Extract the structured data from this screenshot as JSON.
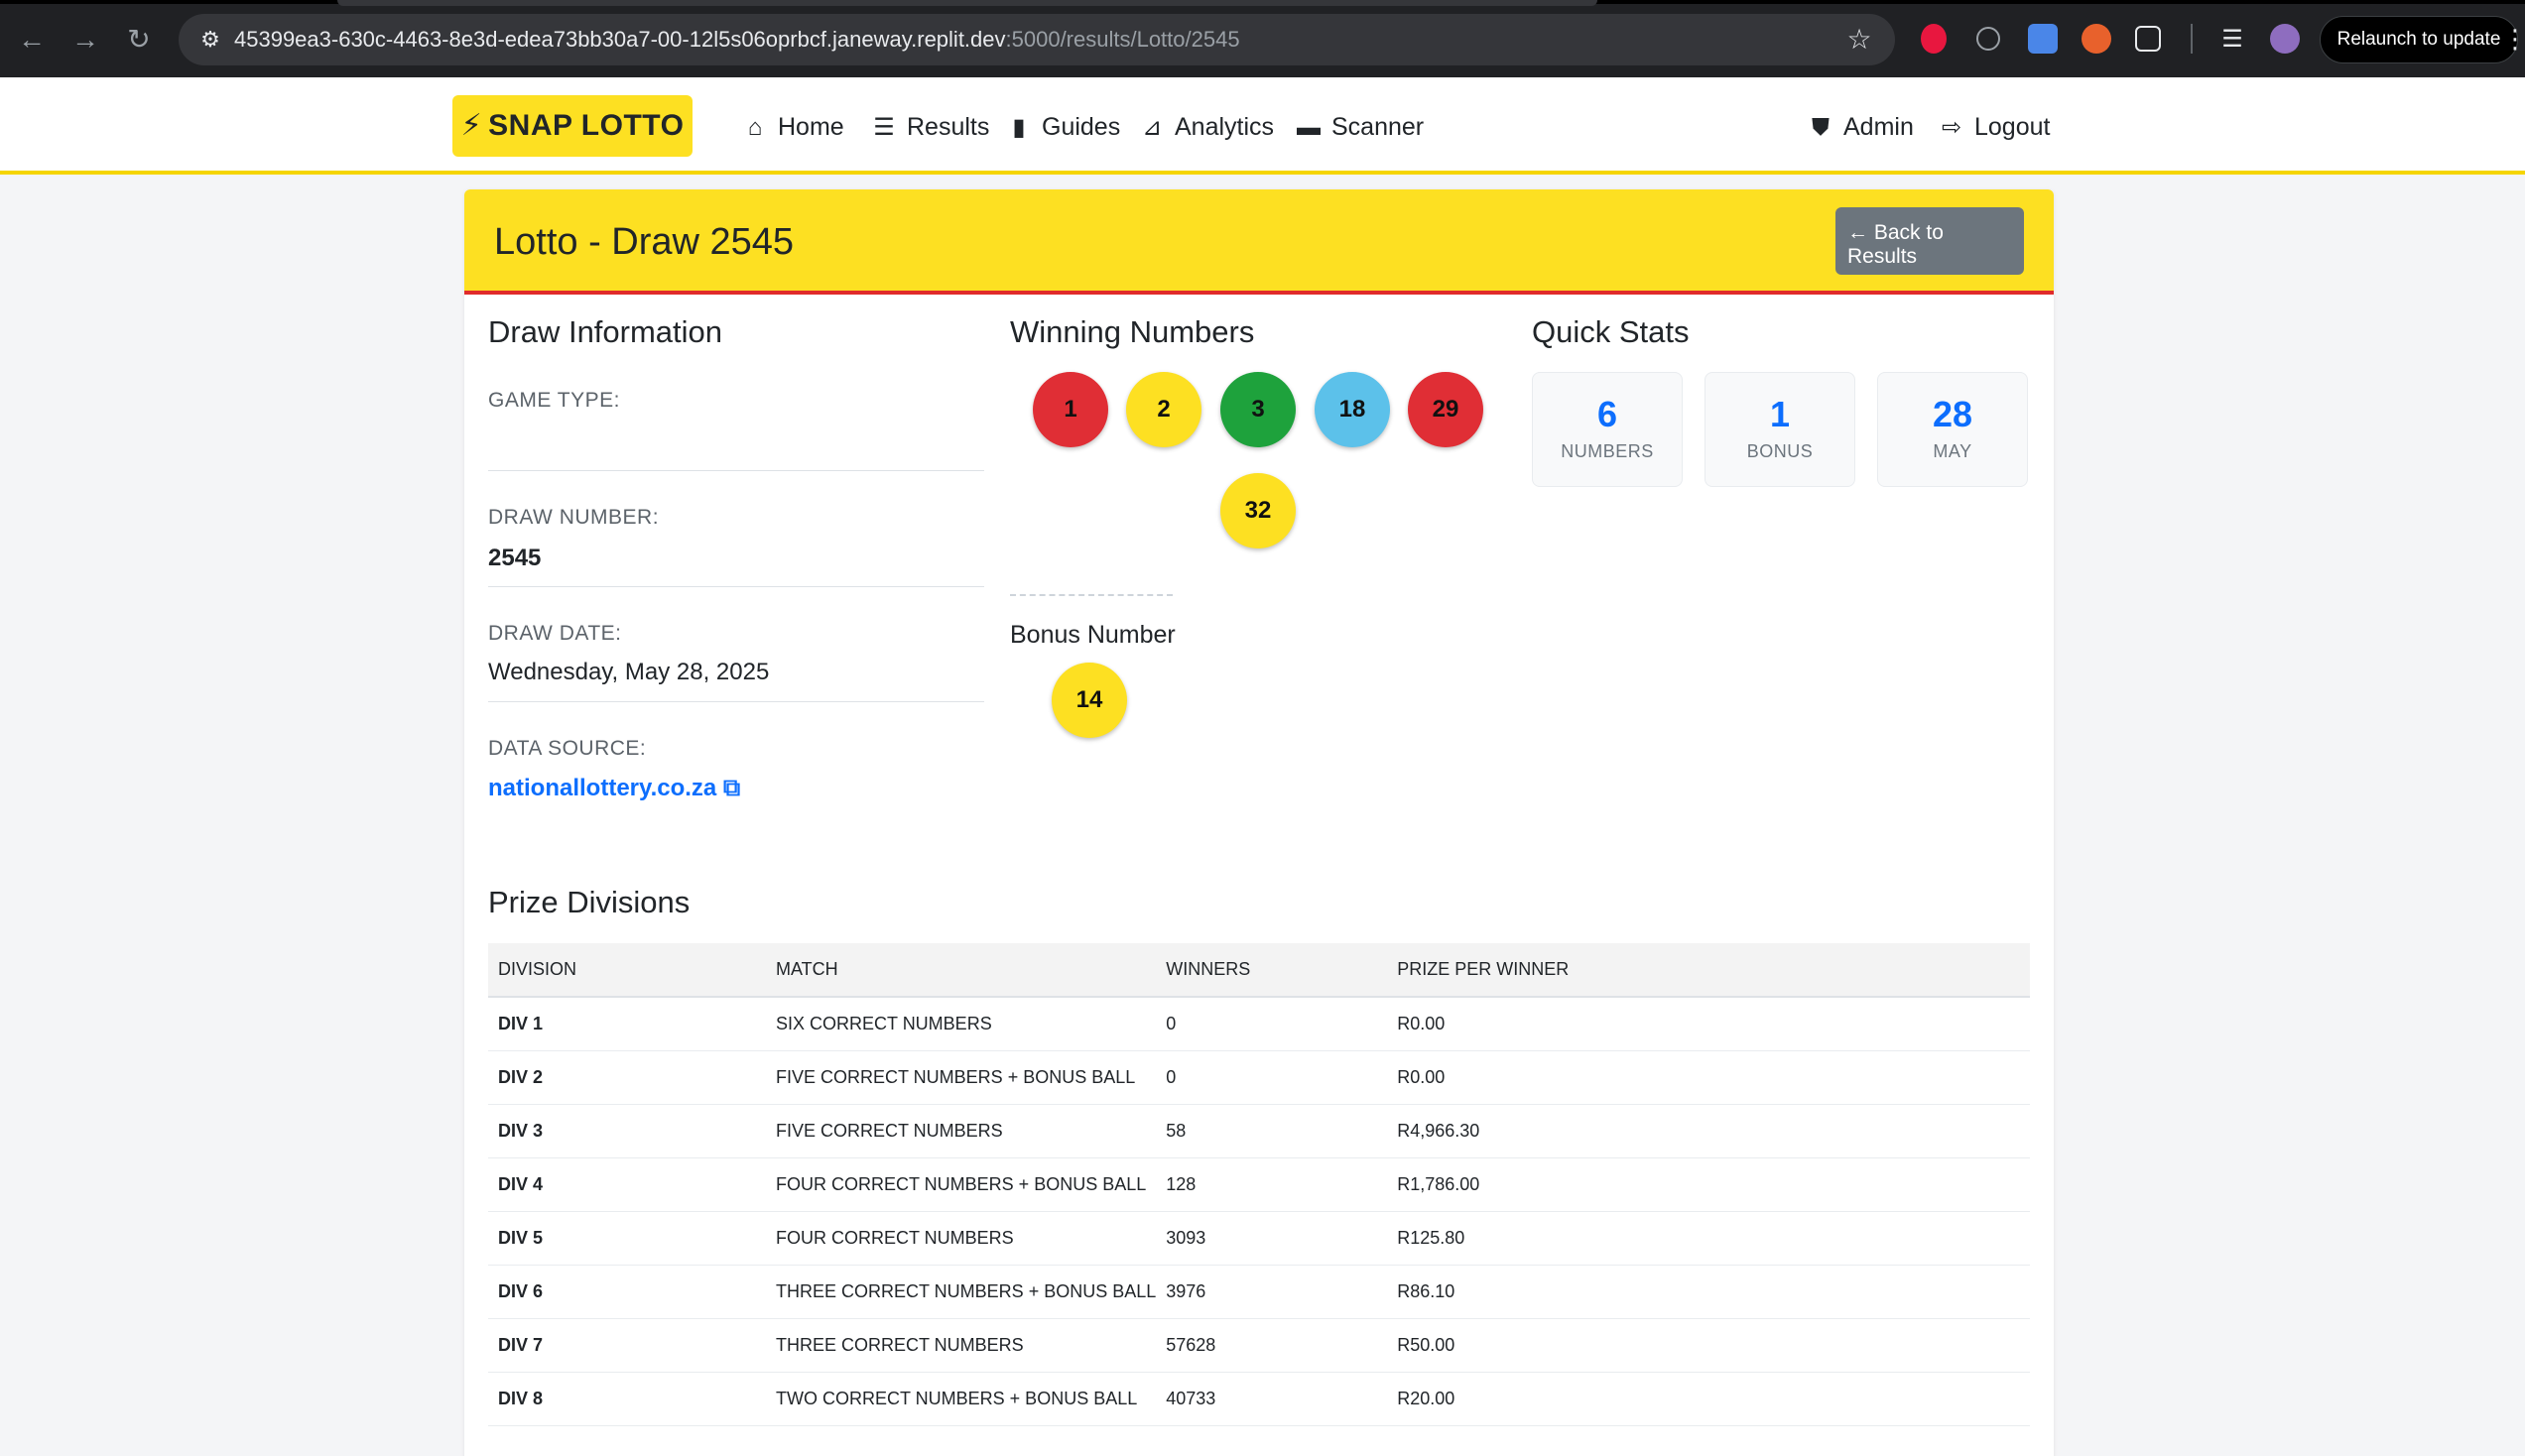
{
  "browser": {
    "url_host": "45399ea3-630c-4463-8e3d-edea73bb30a7-00-12l5s06oprbcf.janeway.replit.dev",
    "url_path": ":5000/results/Lotto/2545",
    "relaunch_label": "Relaunch to update"
  },
  "nav": {
    "brand": "SNAP LOTTO",
    "links": {
      "home": "Home",
      "results": "Results",
      "guides": "Guides",
      "analytics": "Analytics",
      "scanner": "Scanner",
      "admin": "Admin",
      "logout": "Logout"
    }
  },
  "page": {
    "title": "Lotto - Draw 2545",
    "back_label": "Back to Results"
  },
  "draw_info": {
    "heading": "Draw Information",
    "game_type_label": "GAME TYPE:",
    "game_type_value": "",
    "draw_number_label": "DRAW NUMBER:",
    "draw_number_value": "2545",
    "draw_date_label": "DRAW DATE:",
    "draw_date_value": "Wednesday, May 28, 2025",
    "data_source_label": "DATA SOURCE:",
    "data_source_value": "nationallottery.co.za"
  },
  "winning": {
    "heading": "Winning Numbers",
    "numbers": [
      {
        "value": "1",
        "color": "#e02e35",
        "text_color": "#111111"
      },
      {
        "value": "2",
        "color": "#fde022",
        "text_color": "#111111"
      },
      {
        "value": "3",
        "color": "#1ea23c",
        "text_color": "#111111"
      },
      {
        "value": "18",
        "color": "#5cc1ea",
        "text_color": "#111111"
      },
      {
        "value": "29",
        "color": "#e02e35",
        "text_color": "#111111"
      },
      {
        "value": "32",
        "color": "#fde022",
        "text_color": "#111111"
      }
    ],
    "bonus_label": "Bonus Number",
    "bonus": {
      "value": "14",
      "color": "#fde022"
    }
  },
  "quick_stats": {
    "heading": "Quick Stats",
    "items": [
      {
        "value": "6",
        "label": "NUMBERS"
      },
      {
        "value": "1",
        "label": "BONUS"
      },
      {
        "value": "28",
        "label": "MAY"
      }
    ]
  },
  "prize_divisions": {
    "heading": "Prize Divisions",
    "columns": [
      "DIVISION",
      "MATCH",
      "WINNERS",
      "PRIZE PER WINNER"
    ],
    "rows": [
      {
        "division": "DIV 1",
        "match": "SIX CORRECT NUMBERS",
        "winners": "0",
        "prize": "R0.00"
      },
      {
        "division": "DIV 2",
        "match": "FIVE CORRECT NUMBERS + BONUS BALL",
        "winners": "0",
        "prize": "R0.00"
      },
      {
        "division": "DIV 3",
        "match": "FIVE CORRECT NUMBERS",
        "winners": "58",
        "prize": "R4,966.30"
      },
      {
        "division": "DIV 4",
        "match": "FOUR CORRECT NUMBERS + BONUS BALL",
        "winners": "128",
        "prize": "R1,786.00"
      },
      {
        "division": "DIV 5",
        "match": "FOUR CORRECT NUMBERS",
        "winners": "3093",
        "prize": "R125.80"
      },
      {
        "division": "DIV 6",
        "match": "THREE CORRECT NUMBERS + BONUS BALL",
        "winners": "3976",
        "prize": "R86.10"
      },
      {
        "division": "DIV 7",
        "match": "THREE CORRECT NUMBERS",
        "winners": "57628",
        "prize": "R50.00"
      },
      {
        "division": "DIV 8",
        "match": "TWO CORRECT NUMBERS + BONUS BALL",
        "winners": "40733",
        "prize": "R20.00"
      }
    ]
  }
}
